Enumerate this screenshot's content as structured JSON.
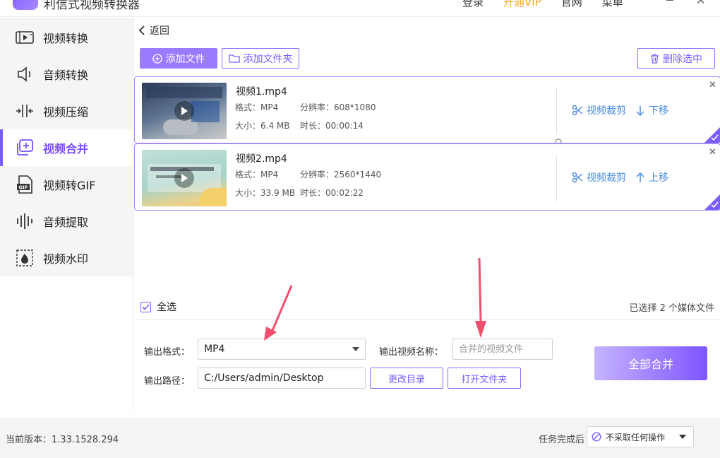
{
  "app": {
    "title": "利信式视频转换器",
    "top_links": [
      "登录",
      "开通VIP",
      "官网",
      "菜单"
    ]
  },
  "sidebar": {
    "items": [
      {
        "label": "视频转换",
        "icon": "video-convert-icon"
      },
      {
        "label": "音频转换",
        "icon": "speaker-icon"
      },
      {
        "label": "视频压缩",
        "icon": "compress-icon"
      },
      {
        "label": "视频合并",
        "icon": "merge-plus-icon",
        "active": true
      },
      {
        "label": "视频转GIF",
        "icon": "gif-file-icon"
      },
      {
        "label": "音频提取",
        "icon": "waveform-icon"
      },
      {
        "label": "视频水印",
        "icon": "watermark-drop-icon"
      }
    ]
  },
  "toolbar": {
    "back_label": "返回",
    "add_file_label": "添加文件",
    "add_folder_label": "添加文件夹",
    "delete_selected_label": "删除选中"
  },
  "files": [
    {
      "name": "视频1.mp4",
      "format_label": "格式：",
      "format": "MP4",
      "resolution_label": "分辨率：",
      "resolution": "608*1080",
      "size_label": "大小：",
      "size": "6.4 MB",
      "duration_label": "时长：",
      "duration": "00:00:14",
      "crop_label": "视频裁剪",
      "move_label": "下移",
      "thumb_colors": [
        "#3f4c6b",
        "#8fa0b5"
      ]
    },
    {
      "name": "视频2.mp4",
      "format_label": "格式：",
      "format": "MP4",
      "resolution_label": "分辨率：",
      "resolution": "2560*1440",
      "size_label": "大小：",
      "size": "33.9 MB",
      "duration_label": "时长：",
      "duration": "00:02:22",
      "crop_label": "视频裁剪",
      "move_label": "上移",
      "thumb_colors": [
        "#a9d3c8",
        "#f2d37a"
      ]
    }
  ],
  "selection": {
    "select_all_label": "全选",
    "selected_count_text": "已选择 2 个媒体文件"
  },
  "output": {
    "format_label": "输出格式：",
    "format_value": "MP4",
    "name_label": "输出视频名称：",
    "name_placeholder": "合并的视频文件",
    "path_label": "输出路径：",
    "path_value": "C:/Users/admin/Desktop",
    "change_dir_label": "更改目录",
    "open_folder_label": "打开文件夹",
    "merge_all_label": "全部合并"
  },
  "status": {
    "version_text": "当前版本：1.33.1528.294",
    "after_task_label": "任务完成后",
    "after_task_value": "不采取任何操作"
  },
  "colors": {
    "accent": "#7b5cff",
    "link": "#4a8ad8",
    "annotation_arrow": "#f0506e"
  }
}
